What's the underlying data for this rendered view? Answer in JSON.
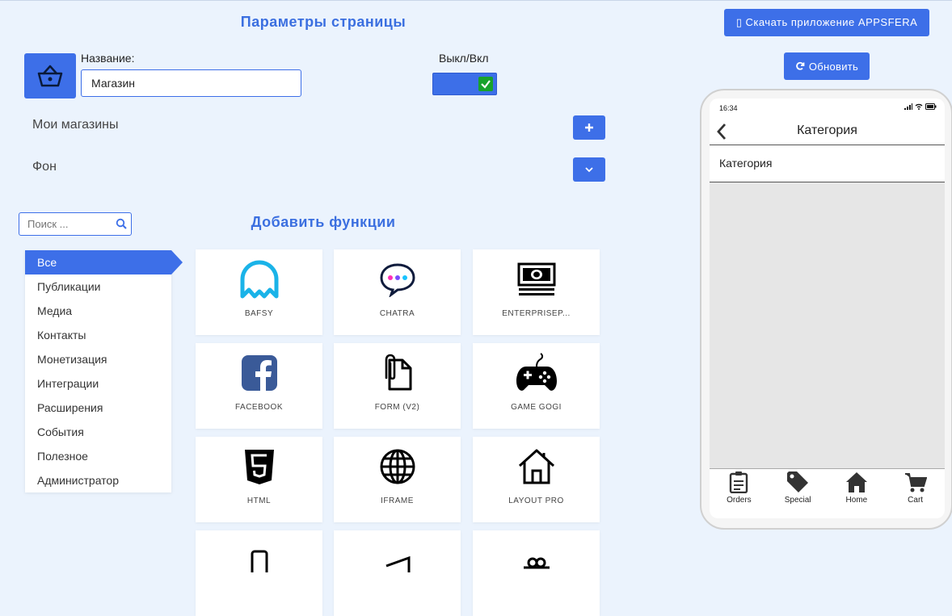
{
  "header": {
    "page_title": "Параметры страницы",
    "name_label": "Название:",
    "name_value": "Магазин",
    "toggle_label": "Выкл/Вкл",
    "toggle_on": true
  },
  "sections": {
    "my_stores": "Мои магазины",
    "background": "Фон"
  },
  "search": {
    "placeholder": "Поиск ..."
  },
  "add_title": "Добавить функции",
  "categories": [
    "Все",
    "Публикации",
    "Медиа",
    "Контакты",
    "Монетизация",
    "Интеграции",
    "Расширения",
    "События",
    "Полезное",
    "Администратор"
  ],
  "active_category": "Все",
  "features": [
    {
      "name": "BAFSY",
      "icon": "bafsy-icon"
    },
    {
      "name": "CHATRA",
      "icon": "chatra-icon"
    },
    {
      "name": "ENTERPRISEP...",
      "icon": "money-icon"
    },
    {
      "name": "FACEBOOK",
      "icon": "facebook-icon"
    },
    {
      "name": "FORM (V2)",
      "icon": "form-icon"
    },
    {
      "name": "GAME GOGI",
      "icon": "gamepad-icon"
    },
    {
      "name": "HTML",
      "icon": "html5-icon"
    },
    {
      "name": "IFRAME",
      "icon": "globe-icon"
    },
    {
      "name": "LAYOUT PRO",
      "icon": "home-icon"
    }
  ],
  "right": {
    "download_label": "▯ Скачать приложение APPSFERA",
    "refresh_label": "Обновить"
  },
  "phone": {
    "time": "16:34",
    "nav_title": "Категория",
    "row_label": "Категория",
    "tabs": [
      "Orders",
      "Special",
      "Home",
      "Cart"
    ]
  },
  "colors": {
    "accent": "#3d6fe8",
    "background": "#ebf3fd",
    "toggle_check": "#17a22c"
  }
}
